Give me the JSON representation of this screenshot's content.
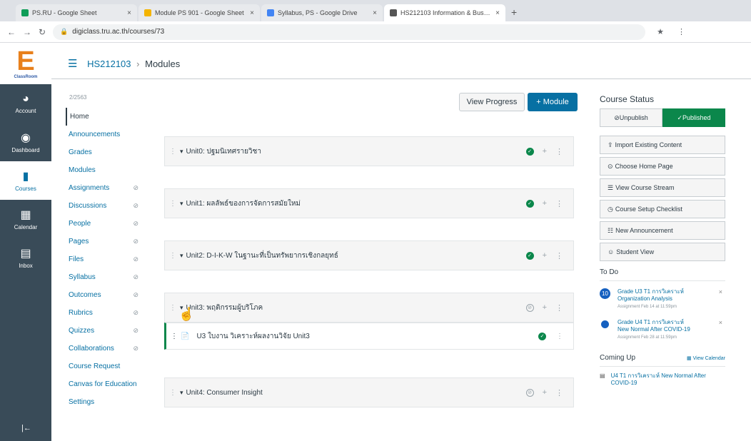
{
  "browser": {
    "tabs": [
      {
        "title": "PS.RU - Google Sheet",
        "color": "#0f9d58"
      },
      {
        "title": "Module PS 901 - Google Sheet",
        "color": "#f4b400"
      },
      {
        "title": "Syllabus, PS - Google Drive",
        "color": "#4285f4"
      },
      {
        "title": "HS212103 Information & Bussiness",
        "color": "#555555"
      }
    ],
    "url": "digiclass.tru.ac.th/courses/73"
  },
  "global_nav": {
    "logo_letter": "E",
    "logo_sub": "ClassRoom",
    "items": [
      {
        "label": "Account",
        "icon": "◕"
      },
      {
        "label": "Dashboard",
        "icon": "◉"
      },
      {
        "label": "Courses",
        "icon": "▮"
      },
      {
        "label": "Calendar",
        "icon": "▦"
      },
      {
        "label": "Inbox",
        "icon": "▤"
      }
    ],
    "collapse_icon": "|←"
  },
  "breadcrumb": {
    "course": "HS212103",
    "page": "Modules"
  },
  "course_nav": {
    "term": "2/2563",
    "items": [
      {
        "label": "Home",
        "hidden": false
      },
      {
        "label": "Announcements",
        "hidden": false
      },
      {
        "label": "Grades",
        "hidden": false
      },
      {
        "label": "Modules",
        "hidden": false
      },
      {
        "label": "Assignments",
        "hidden": true
      },
      {
        "label": "Discussions",
        "hidden": true
      },
      {
        "label": "People",
        "hidden": true
      },
      {
        "label": "Pages",
        "hidden": true
      },
      {
        "label": "Files",
        "hidden": true
      },
      {
        "label": "Syllabus",
        "hidden": true
      },
      {
        "label": "Outcomes",
        "hidden": true
      },
      {
        "label": "Rubrics",
        "hidden": true
      },
      {
        "label": "Quizzes",
        "hidden": true
      },
      {
        "label": "Collaborations",
        "hidden": true
      },
      {
        "label": "Course Request",
        "hidden": false
      },
      {
        "label": "Canvas for Education",
        "hidden": false
      },
      {
        "label": "Settings",
        "hidden": false
      }
    ]
  },
  "toolbar": {
    "view_progress": "View Progress",
    "add_module": "+ Module"
  },
  "modules": [
    {
      "name": "Unit0: ปฐมนิเทศรายวิชา",
      "published": true
    },
    {
      "name": "Unit1: ผลลัพธ์ของการจัดการสมัยใหม่",
      "published": true
    },
    {
      "name": "Unit2: D-I-K-W ในฐานะที่เป็นทรัพยากรเชิงกลยุทธ์",
      "published": true
    },
    {
      "name": "Unit3: พฤติกรรมผู้บริโภค",
      "published": false
    },
    {
      "name": "Unit4: Consumer Insight",
      "published": false
    }
  ],
  "module_item": {
    "name": "U3 ใบงาน วิเคราะห์ผลงานวิจัย Unit3"
  },
  "sidebar": {
    "status_title": "Course Status",
    "unpublish": "Unpublish",
    "published": "Published",
    "buttons": [
      {
        "icon": "⇪",
        "label": "Import Existing Content"
      },
      {
        "icon": "⊙",
        "label": "Choose Home Page"
      },
      {
        "icon": "☰",
        "label": "View Course Stream"
      },
      {
        "icon": "◷",
        "label": "Course Setup Checklist"
      },
      {
        "icon": "☷",
        "label": "New Announcement"
      },
      {
        "icon": "☺",
        "label": "Student View"
      }
    ],
    "todo_title": "To Do",
    "todos": [
      {
        "count": "10",
        "text": "Grade U3 T1 การวิเคราะห์ Organization Analysis",
        "meta": "Assignment Feb 14 at 11:59pm"
      },
      {
        "count": "",
        "text": "Grade U4 T1 การวิเคราะห์ New Normal After COVID-19",
        "meta": "Assignment Feb 28 at 11:59pm"
      }
    ],
    "coming_up_title": "Coming Up",
    "view_calendar": "View Calendar",
    "coming_up_item": "U4 T1 การวิเคราะห์ New Normal After COVID-19"
  }
}
